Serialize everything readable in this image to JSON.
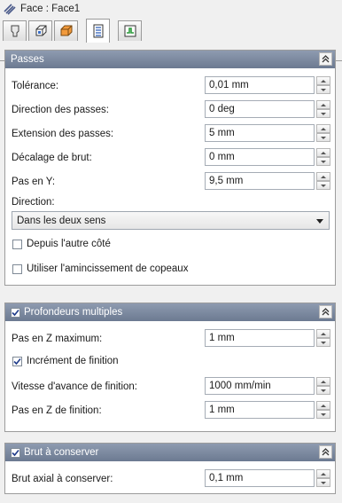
{
  "title": "Face : Face1",
  "tabs": [
    {
      "icon": "tool-icon"
    },
    {
      "icon": "geometry-icon"
    },
    {
      "icon": "stock-icon"
    },
    {
      "icon": "passes-icon"
    },
    {
      "icon": "linking-icon"
    }
  ],
  "passes": {
    "title": "Passes",
    "tolerance_label": "Tolérance:",
    "tolerance_value": "0,01 mm",
    "direction_passes_label": "Direction des passes:",
    "direction_passes_value": "0 deg",
    "extension_label": "Extension des passes:",
    "extension_value": "5 mm",
    "decalage_label": "Décalage de brut:",
    "decalage_value": "0 mm",
    "pas_y_label": "Pas en Y:",
    "pas_y_value": "9,5 mm",
    "direction_label": "Direction:",
    "direction_value": "Dans les deux sens",
    "autre_cote_label": "Depuis l'autre côté",
    "amincissement_label": "Utiliser l'amincissement de copeaux"
  },
  "profondeurs": {
    "title": "Profondeurs multiples",
    "pas_z_max_label": "Pas en Z maximum:",
    "pas_z_max_value": "1 mm",
    "increment_label": "Incrément de finition",
    "vitesse_label": "Vitesse d'avance de finition:",
    "vitesse_value": "1000 mm/min",
    "pas_z_fin_label": "Pas en Z de finition:",
    "pas_z_fin_value": "1 mm"
  },
  "brut": {
    "title": "Brut à conserver",
    "axial_label": "Brut axial à conserver:",
    "axial_value": "0,1 mm"
  }
}
